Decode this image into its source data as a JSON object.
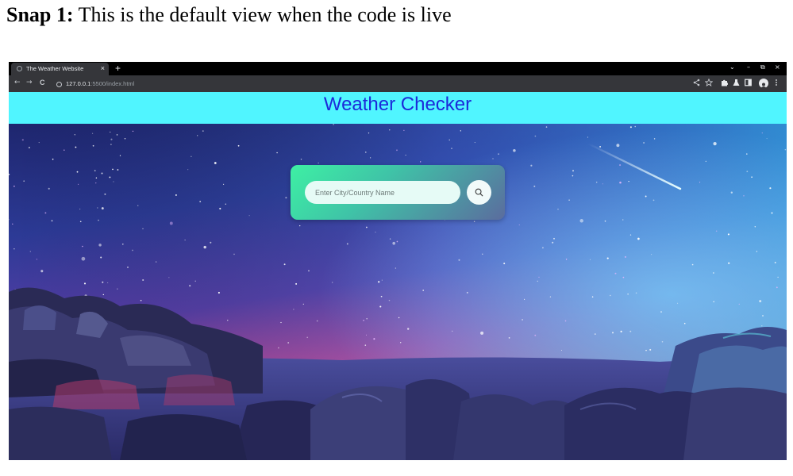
{
  "caption": {
    "label": "Snap 1:",
    "text": " This is the default view when the code is live"
  },
  "browser": {
    "tab_title": "The Weather Website",
    "tab_close": "×",
    "new_tab": "+",
    "address_host": "127.0.0.1",
    "address_path": ":5500/index.html",
    "window_controls": {
      "dropdown": "⌄",
      "minimize": "–",
      "restore": "⧉",
      "close": "×"
    },
    "nav": {
      "back": "←",
      "forward": "→",
      "reload": "C"
    },
    "toolbar_icons": [
      "share-icon",
      "star-icon",
      "extensions-icon",
      "lab-icon",
      "sidepanel-icon",
      "profile-icon",
      "menu-icon"
    ]
  },
  "page": {
    "title": "Weather Checker",
    "search": {
      "placeholder": "Enter City/Country Name",
      "value": ""
    }
  },
  "colors": {
    "header_bg": "#50f5ff",
    "title": "#1c2ad9",
    "card_gradient_start": "#3ef0a4",
    "card_gradient_end": "#5b6c9e"
  }
}
